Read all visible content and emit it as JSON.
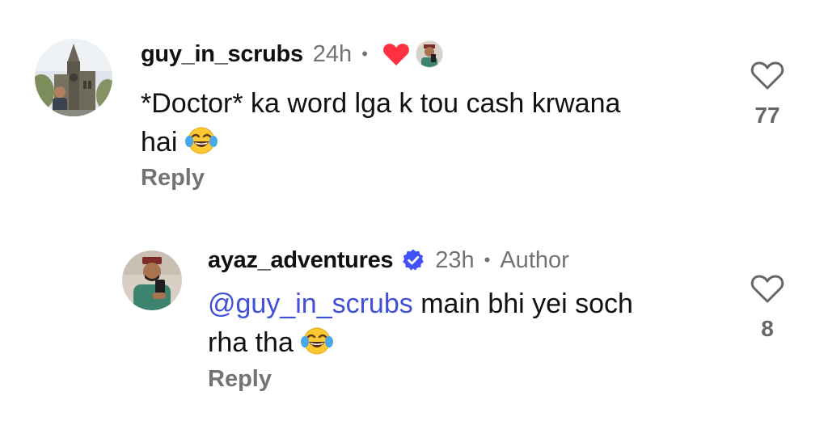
{
  "comments": [
    {
      "username": "guy_in_scrubs",
      "time": "24h",
      "separator": "•",
      "liked_by_author": true,
      "text_part1": "*Doctor* ka word lga k tou cash krwana",
      "text_part2": "hai",
      "emoji": "face-with-tears-of-joy",
      "reply_label": "Reply",
      "likes": "77"
    },
    {
      "username": "ayaz_adventures",
      "verified": true,
      "time": "23h",
      "separator": "•",
      "author_label": "Author",
      "mention": "@guy_in_scrubs",
      "text_part1": " main bhi yei soch",
      "text_part2": "rha tha",
      "emoji": "face-with-tears-of-joy",
      "reply_label": "Reply",
      "likes": "8"
    }
  ],
  "colors": {
    "heart_red": "#ff3040",
    "verified_blue": "#4150f7",
    "mention_blue": "#4150d8",
    "muted_gray": "#737373"
  }
}
